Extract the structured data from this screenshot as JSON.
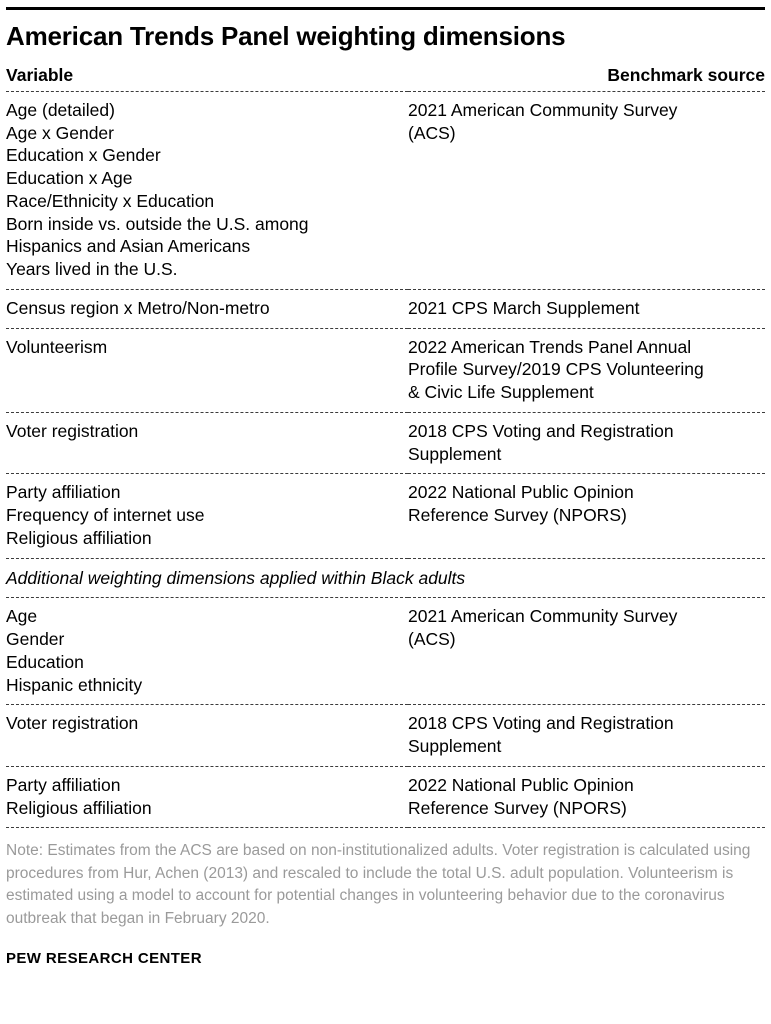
{
  "title": "American Trends Panel weighting dimensions",
  "table": {
    "headers": {
      "variable": "Variable",
      "benchmark_source": "Benchmark source"
    },
    "rows": [
      {
        "variables": [
          "Age (detailed)",
          "Age x Gender",
          "Education x Gender",
          "Education x Age",
          "Race/Ethnicity x Education",
          "Born inside vs. outside the U.S. among\nHispanics and Asian Americans",
          "Years lived in the U.S."
        ],
        "source": "2021 American Community Survey\n(ACS)"
      },
      {
        "variables": [
          "Census region x Metro/Non-metro"
        ],
        "source": "2021 CPS March Supplement"
      },
      {
        "variables": [
          "Volunteerism"
        ],
        "source": "2022 American Trends Panel Annual\nProfile Survey/2019 CPS Volunteering\n& Civic Life Supplement"
      },
      {
        "variables": [
          "Voter registration"
        ],
        "source": "2018 CPS Voting and Registration\nSupplement"
      },
      {
        "variables": [
          "Party affiliation",
          "Frequency of internet use",
          "Religious affiliation"
        ],
        "source": "2022 National Public Opinion\nReference Survey (NPORS)"
      }
    ],
    "section_label": "Additional weighting dimensions applied within Black adults",
    "section_rows": [
      {
        "variables": [
          "Age",
          "Gender",
          "Education",
          "Hispanic ethnicity"
        ],
        "source": "2021 American Community Survey\n(ACS)"
      },
      {
        "variables": [
          "Voter registration"
        ],
        "source": "2018 CPS Voting and Registration\nSupplement"
      },
      {
        "variables": [
          "Party affiliation",
          "Religious affiliation"
        ],
        "source": "2022 National Public Opinion\nReference Survey (NPORS)"
      }
    ]
  },
  "note": "Note: Estimates from the ACS are based on non-institutionalized adults. Voter registration is calculated using procedures from Hur, Achen (2013) and rescaled to include the total U.S. adult population. Volunteerism is estimated using a model to account for potential changes in volunteering behavior due to the coronavirus outbreak that began in February 2020.",
  "footer": "PEW RESEARCH CENTER",
  "colors": {
    "rule": "#000000",
    "divider": "#3c3c3c",
    "note_text": "#9a9a9a",
    "body_text": "#000000"
  }
}
